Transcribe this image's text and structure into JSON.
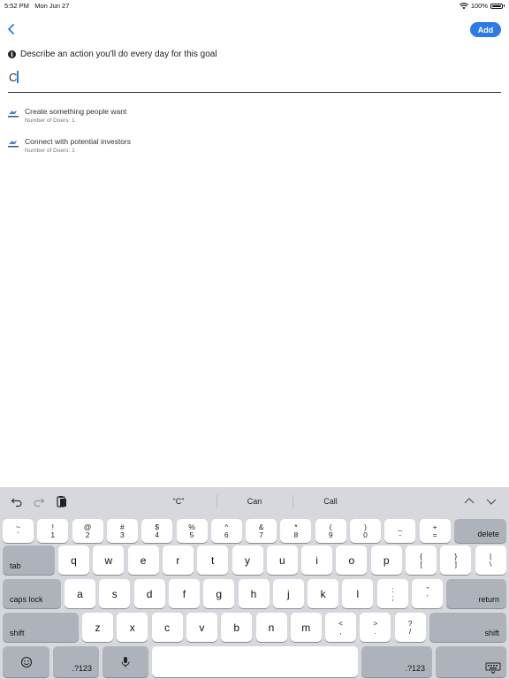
{
  "status_bar": {
    "time": "5:52 PM",
    "date": "Mon Jun 27",
    "battery": "100%",
    "icons": [
      "wifi-icon",
      "battery-icon"
    ]
  },
  "nav": {
    "back_icon": "chevron-left-icon",
    "add_label": "Add"
  },
  "colors": {
    "accent": "#2d7ae5",
    "keyboard_bg": "#d6d8dd",
    "key_dark": "#aeb2ba"
  },
  "prompt": {
    "text": "Describe an action you'll do every day for this goal"
  },
  "input": {
    "value": "C"
  },
  "suggestions": [
    {
      "title": "Create something people want",
      "subtitle": "Number of Doers: 1"
    },
    {
      "title": "Connect with potential investors",
      "subtitle": "Number of Doers: 1"
    }
  ],
  "keyboard": {
    "toolbar_icons": [
      "undo-icon",
      "redo-icon",
      "paste-icon",
      "chevron-up-icon",
      "chevron-down-icon"
    ],
    "predictions": [
      "“C”",
      "Can",
      "Call"
    ],
    "row1": [
      {
        "top": "~",
        "bottom": "`"
      },
      {
        "top": "!",
        "bottom": "1"
      },
      {
        "top": "@",
        "bottom": "2"
      },
      {
        "top": "#",
        "bottom": "3"
      },
      {
        "top": "$",
        "bottom": "4"
      },
      {
        "top": "%",
        "bottom": "5"
      },
      {
        "top": "^",
        "bottom": "6"
      },
      {
        "top": "&",
        "bottom": "7"
      },
      {
        "top": "*",
        "bottom": "8"
      },
      {
        "top": "(",
        "bottom": "9"
      },
      {
        "top": ")",
        "bottom": "0"
      },
      {
        "top": "_",
        "bottom": "-"
      },
      {
        "top": "+",
        "bottom": "="
      }
    ],
    "row2": [
      "q",
      "w",
      "e",
      "r",
      "t",
      "y",
      "u",
      "i",
      "o",
      "p"
    ],
    "row2_extra": [
      {
        "top": "{",
        "bottom": "["
      },
      {
        "top": "}",
        "bottom": "]"
      },
      {
        "top": "|",
        "bottom": "\\"
      }
    ],
    "row3": [
      "a",
      "s",
      "d",
      "f",
      "g",
      "h",
      "j",
      "k",
      "l"
    ],
    "row3_extra": [
      {
        "top": ":",
        "bottom": ";"
      },
      {
        "top": "”",
        "bottom": "’"
      }
    ],
    "row4": [
      "z",
      "x",
      "c",
      "v",
      "b",
      "n",
      "m"
    ],
    "row4_extra": [
      {
        "top": "<",
        "bottom": ","
      },
      {
        "top": ">",
        "bottom": "."
      },
      {
        "top": "?",
        "bottom": "/"
      }
    ],
    "labels": {
      "delete": "delete",
      "tab": "tab",
      "caps_lock": "caps lock",
      "return": "return",
      "shift_left": "shift",
      "shift_right": "shift",
      "numbers_left": ".?123",
      "numbers_right": ".?123"
    },
    "bottom_icons": [
      "emoji-icon",
      "microphone-icon",
      "keyboard-dismiss-icon"
    ]
  }
}
